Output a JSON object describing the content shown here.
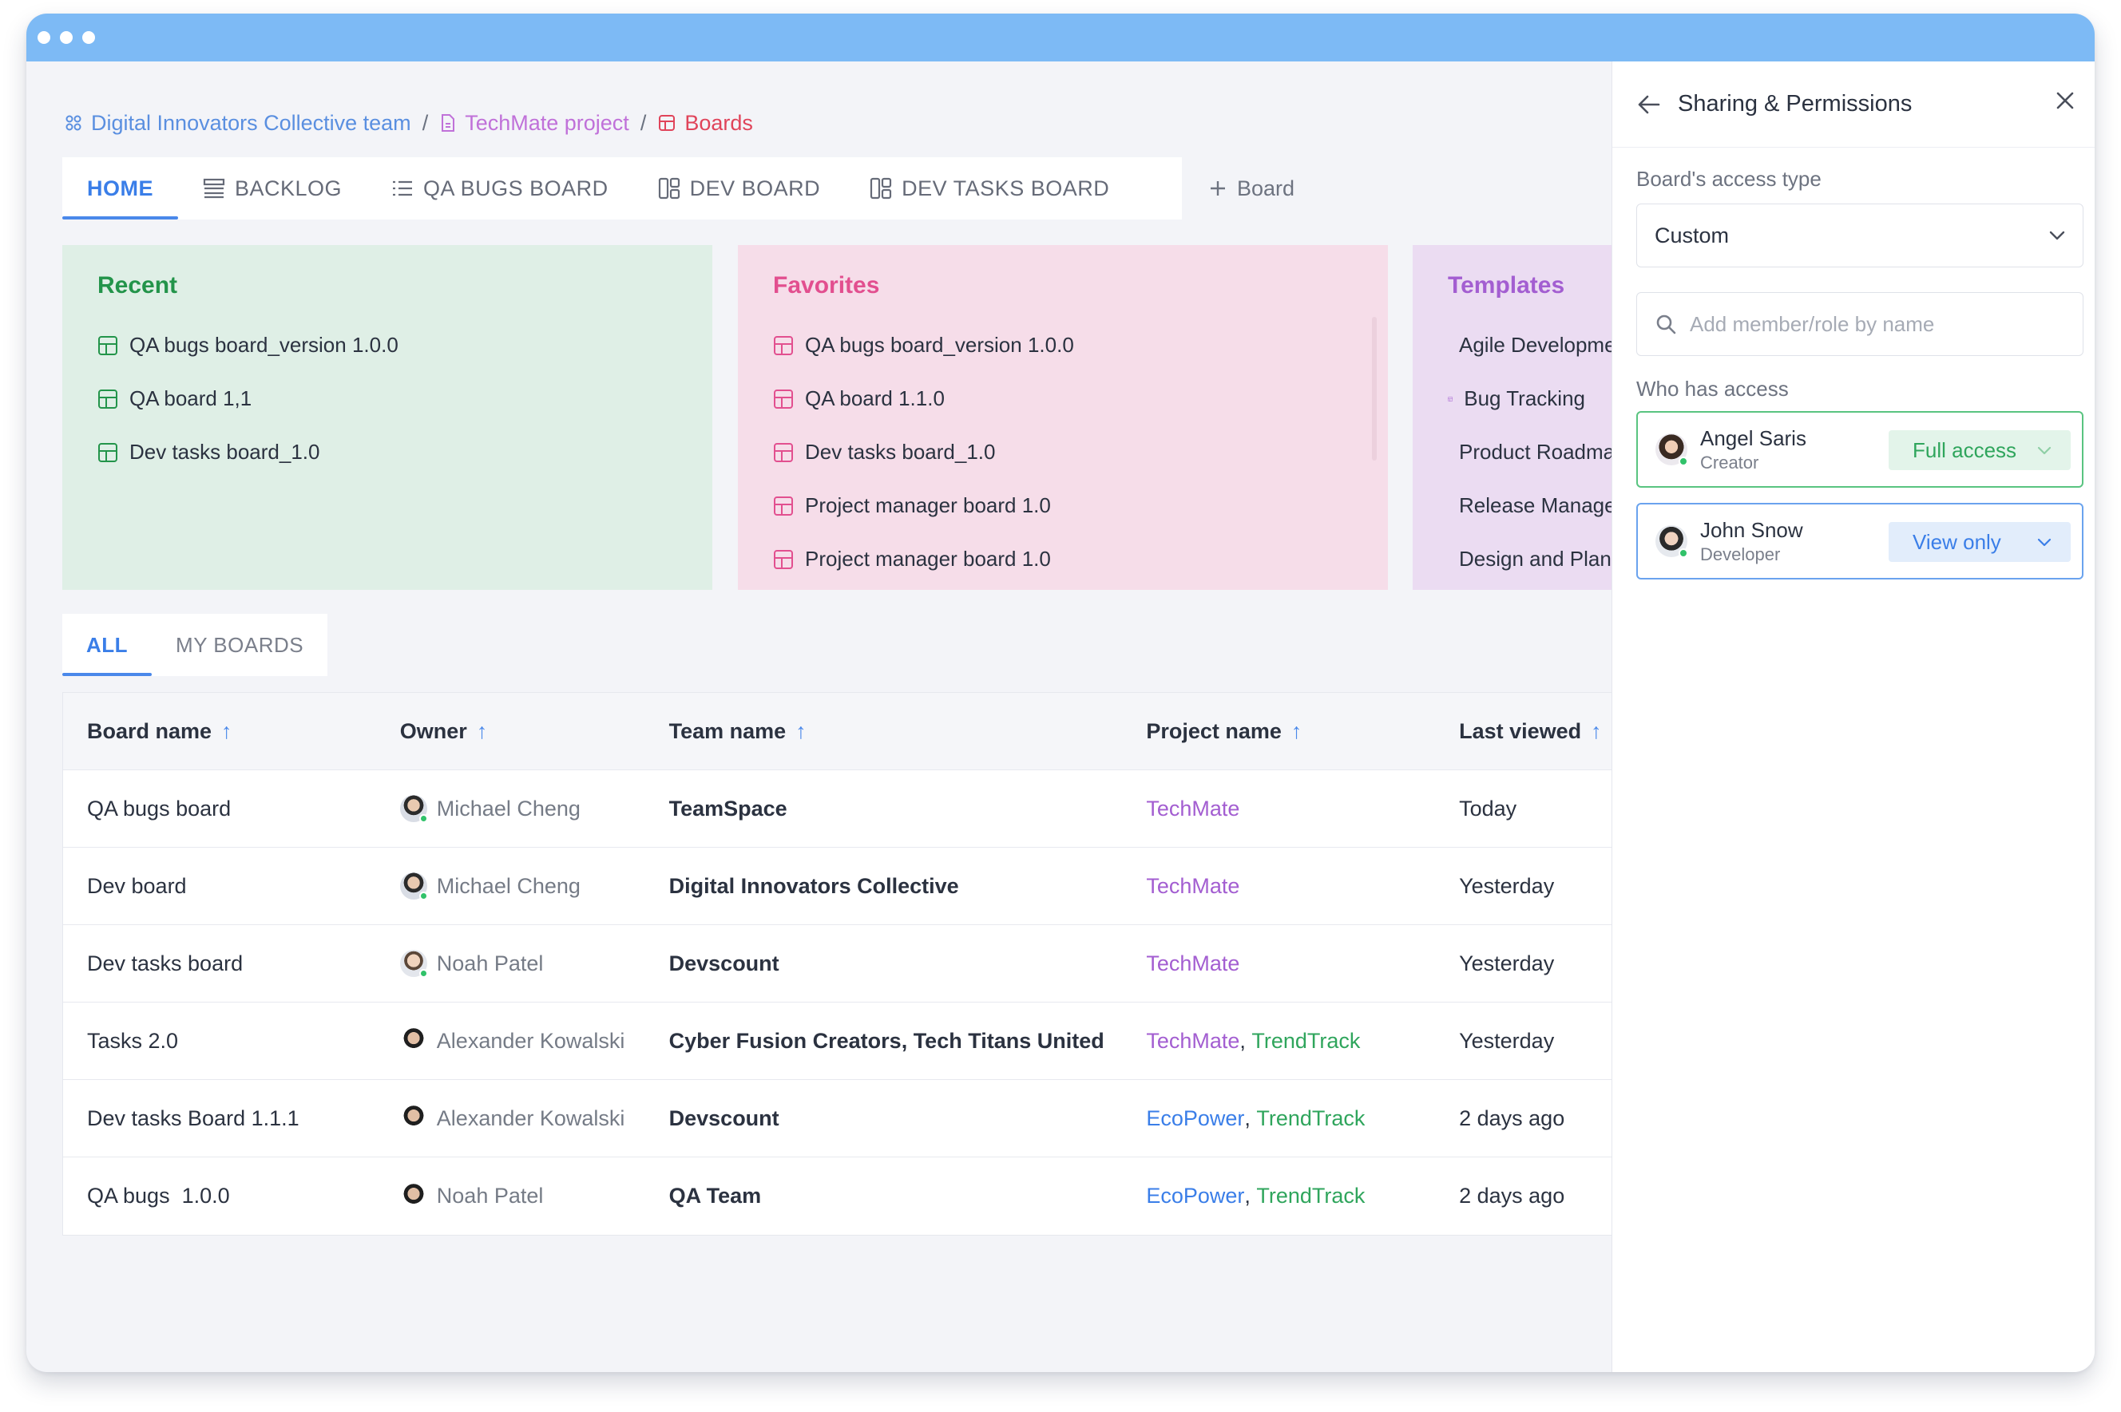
{
  "breadcrumb": {
    "team": "Digital Innovators Collective team",
    "project": "TechMate project",
    "current": "Boards",
    "separator": "/"
  },
  "board_tabs": [
    {
      "label": "HOME",
      "icon": "none",
      "active": true
    },
    {
      "label": "BACKLOG",
      "icon": "backlog-icon",
      "active": false
    },
    {
      "label": "QA BUGS BOARD",
      "icon": "list-icon",
      "active": false
    },
    {
      "label": "DEV BOARD",
      "icon": "board-icon",
      "active": false
    },
    {
      "label": "DEV TASKS BOARD",
      "icon": "board-icon",
      "active": false
    }
  ],
  "add_board_label": "Board",
  "cards": {
    "recent": {
      "title": "Recent",
      "items": [
        "QA bugs board_version 1.0.0",
        "QA board 1,1",
        "Dev tasks board_1.0"
      ]
    },
    "favorites": {
      "title": "Favorites",
      "items": [
        "QA bugs board_version 1.0.0",
        "QA board 1.1.0",
        "Dev tasks board_1.0",
        "Project manager board 1.0",
        "Project manager board 1.0"
      ]
    },
    "templates": {
      "title": "Templates",
      "items": [
        "Agile Development",
        "Bug Tracking",
        "Product Roadmap",
        "Release Management",
        "Design and Planning"
      ]
    }
  },
  "view_tabs": [
    {
      "label": "ALL",
      "active": true
    },
    {
      "label": "MY BOARDS",
      "active": false
    }
  ],
  "table": {
    "headers": [
      "Board name",
      "Owner",
      "Team name",
      "Project name",
      "Last viewed"
    ],
    "sort_icon": "arrow-up-icon",
    "rows": [
      {
        "board": "QA bugs board",
        "owner": "Michael Cheng",
        "team": "TeamSpace",
        "projects": [
          {
            "name": "TechMate",
            "color": "purple"
          }
        ],
        "last": "Today"
      },
      {
        "board": "Dev board",
        "owner": "Michael Cheng",
        "team": "Digital Innovators Collective",
        "projects": [
          {
            "name": "TechMate",
            "color": "purple"
          }
        ],
        "last": "Yesterday"
      },
      {
        "board": "Dev tasks board",
        "owner": "Noah Patel",
        "team": "Devscount",
        "projects": [
          {
            "name": "TechMate",
            "color": "purple"
          }
        ],
        "last": "Yesterday"
      },
      {
        "board": "Tasks 2.0",
        "owner": "Alexander Kowalski",
        "team": "Cyber Fusion Creators, Tech Titans United",
        "projects": [
          {
            "name": "TechMate",
            "color": "purple"
          },
          {
            "name": "TrendTrack",
            "color": "green"
          }
        ],
        "last": "Yesterday"
      },
      {
        "board": "Dev tasks Board 1.1.1",
        "owner": "Alexander Kowalski",
        "team": "Devscount",
        "projects": [
          {
            "name": "EcoPower",
            "color": "blue"
          },
          {
            "name": "TrendTrack",
            "color": "green"
          }
        ],
        "last": "2 days ago"
      },
      {
        "board": "QA bugs  1.0.0",
        "owner": "Noah Patel",
        "team": "QA Team",
        "projects": [
          {
            "name": "EcoPower",
            "color": "blue"
          },
          {
            "name": "TrendTrack",
            "color": "green"
          }
        ],
        "last": "2 days ago"
      }
    ]
  },
  "panel": {
    "title": "Sharing & Permissions",
    "access_type_label": "Board's access type",
    "access_type_value": "Custom",
    "search_placeholder": "Add member/role by name",
    "who_has_access_label": "Who has access",
    "members": [
      {
        "name": "Angel Saris",
        "role": "Creator",
        "access": "Full access",
        "style": "full"
      },
      {
        "name": "John Snow",
        "role": "Developer",
        "access": "View only",
        "style": "view"
      }
    ]
  },
  "colors": {
    "titlebar": "#7dbaf5",
    "accent_blue": "#3a7ee8",
    "project_purple": "#a35ed1",
    "project_green": "#2fa55c",
    "recent_bg": "#dfefe6",
    "favorites_bg": "#f6dde9",
    "templates_bg": "#ebdcf2"
  }
}
